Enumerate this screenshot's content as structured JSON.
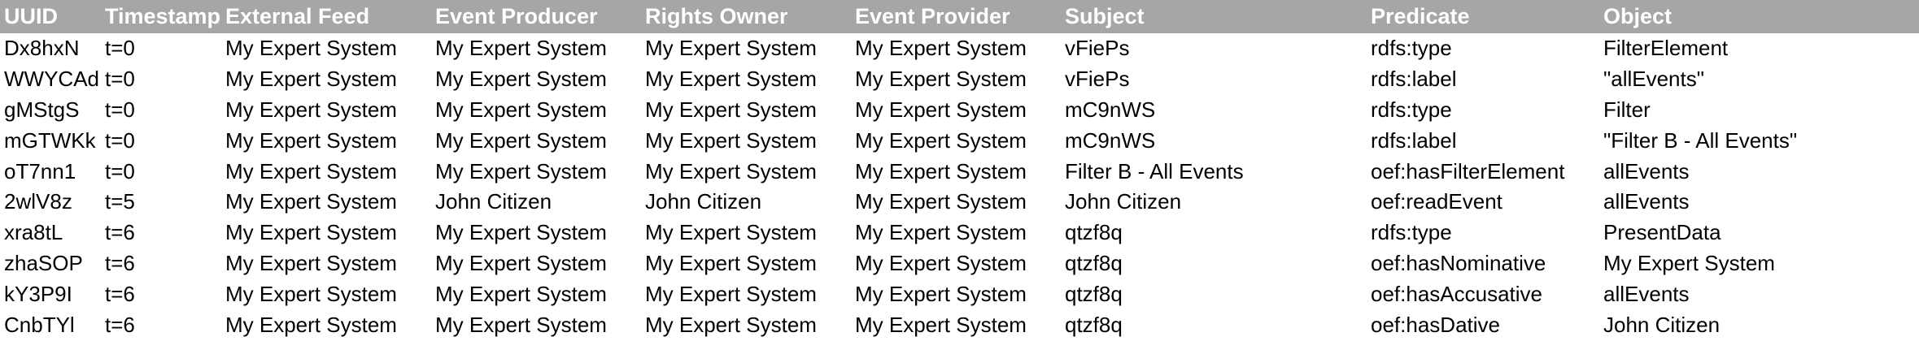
{
  "headers": [
    "UUID",
    "Timestamp",
    "External Feed",
    "Event Producer",
    "Rights Owner",
    "Event Provider",
    "Subject",
    "Predicate",
    "Object"
  ],
  "rows": [
    [
      "Dx8hxN",
      "t=0",
      "My Expert System",
      "My Expert System",
      "My Expert System",
      "My Expert System",
      "vFiePs",
      "rdfs:type",
      "FilterElement"
    ],
    [
      "WWYCAd",
      "t=0",
      "My Expert System",
      "My Expert System",
      "My Expert System",
      "My Expert System",
      "vFiePs",
      "rdfs:label",
      "\"allEvents\""
    ],
    [
      "gMStgS",
      "t=0",
      "My Expert System",
      "My Expert System",
      "My Expert System",
      "My Expert System",
      "mC9nWS",
      "rdfs:type",
      "Filter"
    ],
    [
      "mGTWKk",
      "t=0",
      "My Expert System",
      "My Expert System",
      "My Expert System",
      "My Expert System",
      "mC9nWS",
      "rdfs:label",
      "\"Filter B - All Events\""
    ],
    [
      "oT7nn1",
      "t=0",
      "My Expert System",
      "My Expert System",
      "My Expert System",
      "My Expert System",
      "Filter B - All Events",
      "oef:hasFilterElement",
      "allEvents"
    ],
    [
      "2wlV8z",
      "t=5",
      "My Expert System",
      "John Citizen",
      "John Citizen",
      "My Expert System",
      "John Citizen",
      "oef:readEvent",
      "allEvents"
    ],
    [
      "xra8tL",
      "t=6",
      "My Expert System",
      "My Expert System",
      "My Expert System",
      "My Expert System",
      "qtzf8q",
      "rdfs:type",
      "PresentData"
    ],
    [
      "zhaSOP",
      "t=6",
      "My Expert System",
      "My Expert System",
      "My Expert System",
      "My Expert System",
      "qtzf8q",
      "oef:hasNominative",
      "My Expert System"
    ],
    [
      "kY3P9I",
      "t=6",
      "My Expert System",
      "My Expert System",
      "My Expert System",
      "My Expert System",
      "qtzf8q",
      "oef:hasAccusative",
      "allEvents"
    ],
    [
      "CnbTYl",
      "t=6",
      "My Expert System",
      "My Expert System",
      "My Expert System",
      "My Expert System",
      "qtzf8q",
      "oef:hasDative",
      "John Citizen"
    ]
  ]
}
